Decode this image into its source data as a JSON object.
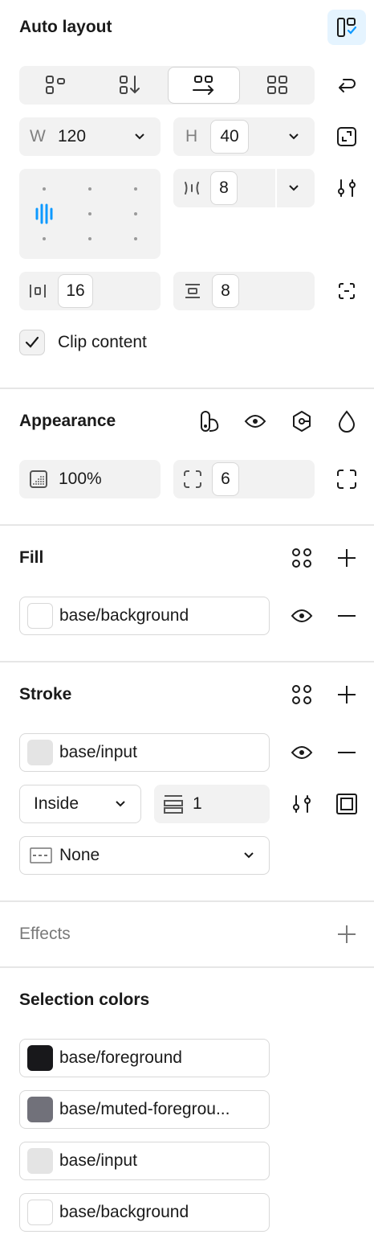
{
  "auto_layout": {
    "title": "Auto layout",
    "width_label": "W",
    "width_value": "120",
    "height_label": "H",
    "height_value": "40",
    "gap_value": "8",
    "padding_horizontal": "16",
    "padding_vertical": "8",
    "clip_content_label": "Clip content",
    "clip_content_checked": true,
    "direction_selected": "horizontal"
  },
  "appearance": {
    "title": "Appearance",
    "opacity_value": "100%",
    "radius_value": "6"
  },
  "fill": {
    "title": "Fill",
    "items": [
      {
        "name": "base/background",
        "color": "#ffffff"
      }
    ]
  },
  "stroke": {
    "title": "Stroke",
    "items": [
      {
        "name": "base/input",
        "color": "#e4e4e4"
      }
    ],
    "position": "Inside",
    "weight": "1",
    "dash": "None"
  },
  "effects": {
    "title": "Effects"
  },
  "selection_colors": {
    "title": "Selection colors",
    "items": [
      {
        "name": "base/foreground",
        "color": "#18181b"
      },
      {
        "name": "base/muted-foregrou...",
        "color": "#71717a"
      },
      {
        "name": "base/input",
        "color": "#e4e4e4"
      },
      {
        "name": "base/background",
        "color": "#ffffff"
      }
    ]
  },
  "colors": {
    "accent": "#0d99ff",
    "panel_field": "#f2f2f2",
    "toggle_bg": "#e5f4ff"
  }
}
